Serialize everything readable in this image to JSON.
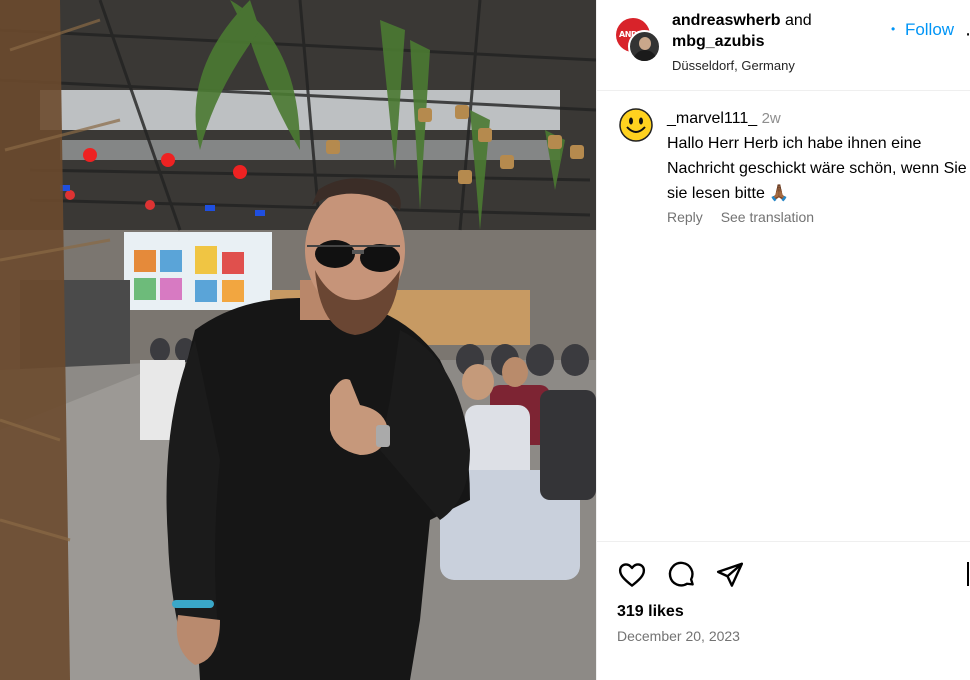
{
  "post": {
    "owner": "andreaswherb",
    "collaborator": "mbg_azubis",
    "joiner": "and",
    "location": "Düsseldorf, Germany",
    "follow_label": "Follow",
    "more_icon": "ellipsis-icon",
    "avatar_logo_text": "ANDREAS"
  },
  "comments": [
    {
      "username": "_marvel111_",
      "time": "2w",
      "text": "Hallo Herr Herb ich habe ihnen eine Nachricht geschickt wäre schön, wenn Sie sie lesen bitte 🙏🏾",
      "reply_label": "Reply",
      "translate_label": "See translation",
      "avatar_icon": "smiley-face-icon"
    }
  ],
  "actions": {
    "like_icon": "heart-icon",
    "comment_icon": "comment-bubble-icon",
    "share_icon": "paper-plane-icon",
    "save_icon": "bookmark-icon",
    "likes_text": "319 likes",
    "date_text": "December 20, 2023"
  },
  "colors": {
    "accent": "#0095f6",
    "secondary_text": "#737373",
    "divider": "#efefef"
  }
}
